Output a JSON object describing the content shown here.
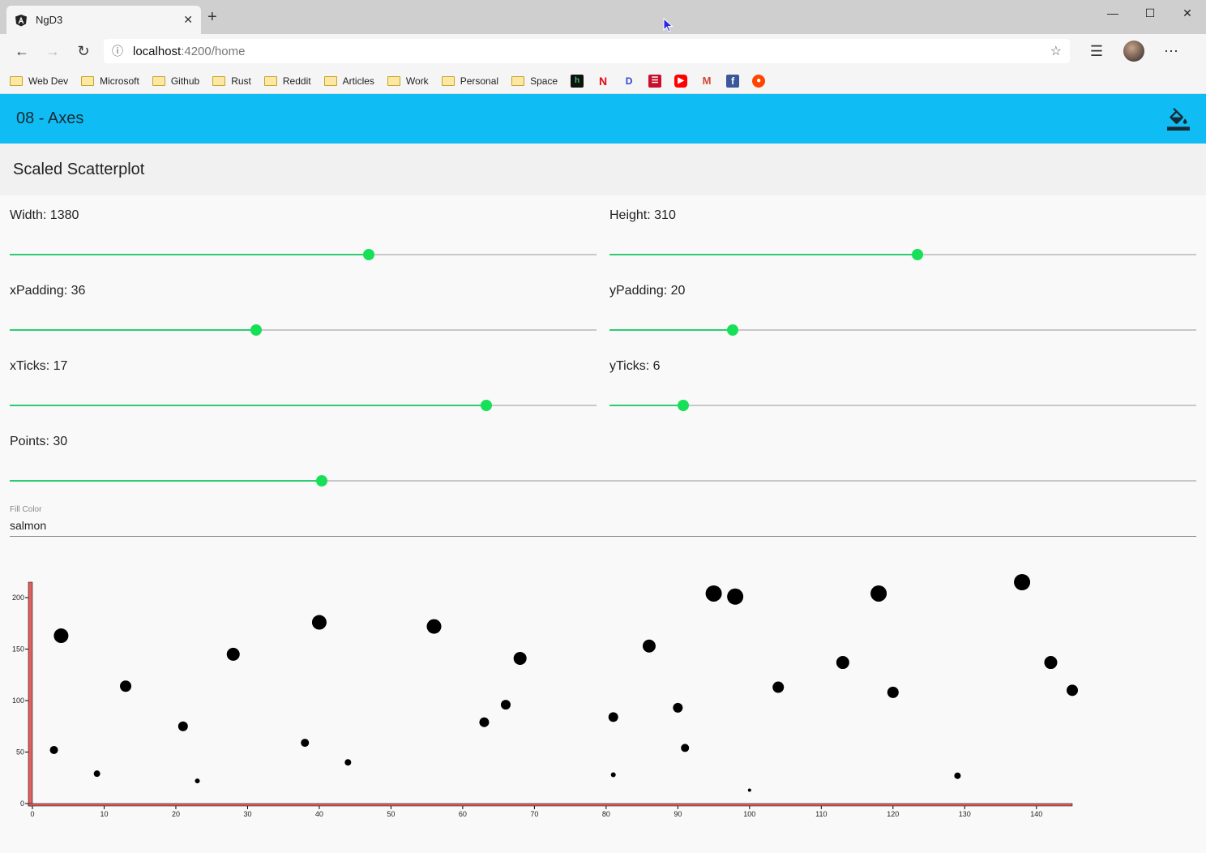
{
  "browser": {
    "tab_title": "NgD3",
    "tab_close": "✕",
    "new_tab": "+",
    "url_host": "localhost",
    "url_path": ":4200/home",
    "bookmarks": [
      "Web Dev",
      "Microsoft",
      "Github",
      "Rust",
      "Reddit",
      "Articles",
      "Work",
      "Personal",
      "Space"
    ],
    "bookmark_icons": [
      "hackerrank-icon",
      "netflix-icon",
      "disney-plus-icon",
      "books-icon",
      "youtube-icon",
      "gmail-icon",
      "facebook-icon",
      "reddit-icon"
    ]
  },
  "app": {
    "title": "08 - Axes",
    "card_title": "Scaled Scatterplot"
  },
  "controls": {
    "width": {
      "label": "Width: 1380",
      "fraction": 0.612
    },
    "height": {
      "label": "Height: 310",
      "fraction": 0.525
    },
    "xpadding": {
      "label": "xPadding: 36",
      "fraction": 0.42
    },
    "ypadding": {
      "label": "yPadding: 20",
      "fraction": 0.21
    },
    "xticks": {
      "label": "xTicks: 17",
      "fraction": 0.812
    },
    "yticks": {
      "label": "yTicks: 6",
      "fraction": 0.125
    },
    "points": {
      "label": "Points: 30",
      "fraction": 0.263
    },
    "fill_color": {
      "label": "Fill Color",
      "value": "salmon"
    }
  },
  "colors": {
    "appbar": "#10bcf4",
    "slider_active": "#17e058",
    "axis": "#e06060",
    "points": "#000000"
  },
  "chart_data": {
    "type": "scatter",
    "xlim": [
      0,
      145
    ],
    "ylim": [
      0,
      215
    ],
    "x_ticks": [
      0,
      10,
      20,
      30,
      40,
      50,
      60,
      70,
      80,
      90,
      100,
      110,
      120,
      130,
      140
    ],
    "y_ticks": [
      0,
      50,
      100,
      150,
      200
    ],
    "points": [
      {
        "x": 3,
        "y": 52,
        "r": 5
      },
      {
        "x": 4,
        "y": 163,
        "r": 9
      },
      {
        "x": 9,
        "y": 29,
        "r": 4
      },
      {
        "x": 13,
        "y": 114,
        "r": 7
      },
      {
        "x": 21,
        "y": 75,
        "r": 6
      },
      {
        "x": 23,
        "y": 22,
        "r": 3
      },
      {
        "x": 28,
        "y": 145,
        "r": 8
      },
      {
        "x": 38,
        "y": 59,
        "r": 5
      },
      {
        "x": 40,
        "y": 176,
        "r": 9
      },
      {
        "x": 44,
        "y": 40,
        "r": 4
      },
      {
        "x": 56,
        "y": 172,
        "r": 9
      },
      {
        "x": 63,
        "y": 79,
        "r": 6
      },
      {
        "x": 66,
        "y": 96,
        "r": 6
      },
      {
        "x": 68,
        "y": 141,
        "r": 8
      },
      {
        "x": 81,
        "y": 84,
        "r": 6
      },
      {
        "x": 81,
        "y": 28,
        "r": 3
      },
      {
        "x": 86,
        "y": 153,
        "r": 8
      },
      {
        "x": 90,
        "y": 93,
        "r": 6
      },
      {
        "x": 91,
        "y": 54,
        "r": 5
      },
      {
        "x": 95,
        "y": 204,
        "r": 10
      },
      {
        "x": 98,
        "y": 201,
        "r": 10
      },
      {
        "x": 100,
        "y": 13,
        "r": 2
      },
      {
        "x": 104,
        "y": 113,
        "r": 7
      },
      {
        "x": 113,
        "y": 137,
        "r": 8
      },
      {
        "x": 118,
        "y": 204,
        "r": 10
      },
      {
        "x": 120,
        "y": 108,
        "r": 7
      },
      {
        "x": 129,
        "y": 27,
        "r": 4
      },
      {
        "x": 138,
        "y": 215,
        "r": 10
      },
      {
        "x": 142,
        "y": 137,
        "r": 8
      },
      {
        "x": 145,
        "y": 110,
        "r": 7
      }
    ]
  }
}
